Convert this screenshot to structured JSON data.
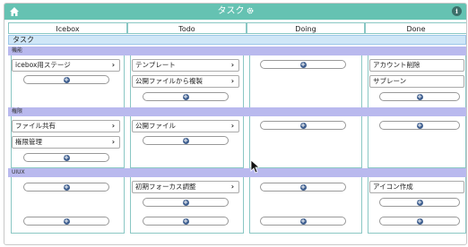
{
  "header": {
    "title": "タスク",
    "info_label": "i",
    "icons": [
      "home-icon",
      "gear-icon",
      "info-icon"
    ]
  },
  "columns": [
    "Icebox",
    "Todo",
    "Doing",
    "Done"
  ],
  "group": {
    "label": "タスク"
  },
  "sections": [
    {
      "label": "機能"
    },
    {
      "label": "権限"
    },
    {
      "label": "UIUX"
    }
  ],
  "cards": {
    "icebox_feature_1": "icebox用ステージ",
    "todo_feature_1": "テンプレート",
    "todo_feature_2": "公開ファイルから複製",
    "done_feature_1": "アカウント削除",
    "done_feature_2": "サブレーン",
    "icebox_perm_1": "ファイル共有",
    "icebox_perm_2": "権限管理",
    "todo_perm_1": "公開ファイル",
    "todo_uiux_1": "初期フォーカス調整",
    "done_uiux_1": "アイコン作成"
  },
  "colors": {
    "titlebar": "#65c2b2",
    "section_bar": "#b9b9ee",
    "group_bar": "#cfe6f7",
    "column_border": "#8ac7c4",
    "add_icon": "#3f5f8f"
  }
}
